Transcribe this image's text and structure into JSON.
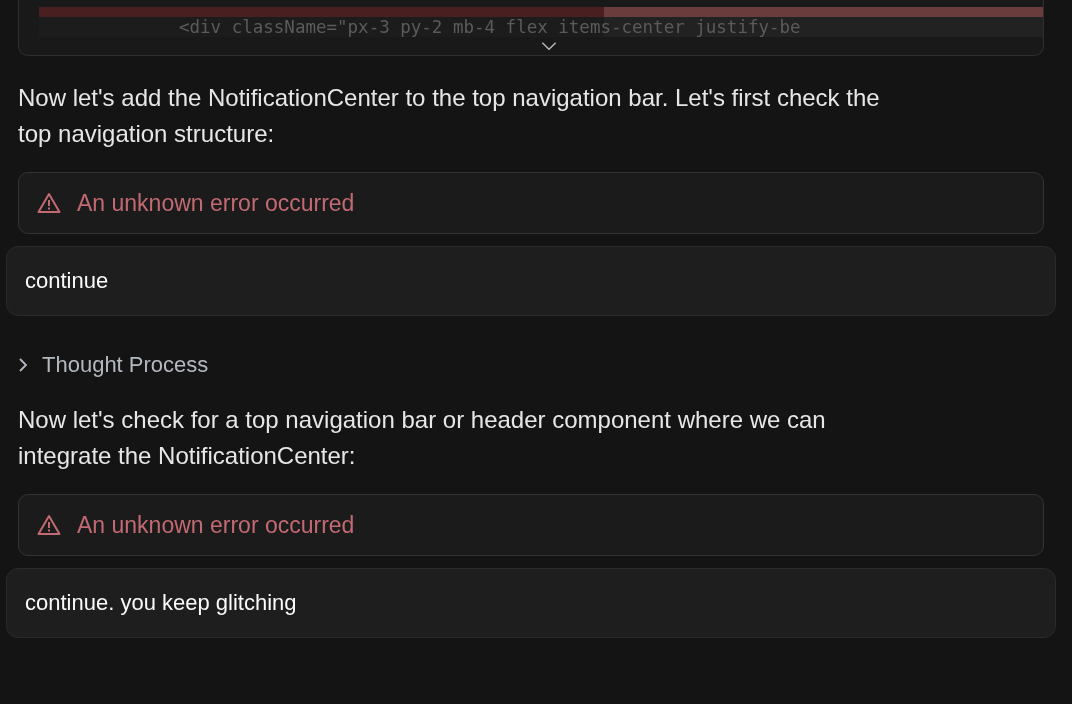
{
  "code_block": {
    "line": "<div className=\"px-3 py-2 mb-4 flex items-center justify-be"
  },
  "messages": [
    {
      "kind": "text",
      "text": "Now let's add the NotificationCenter to the top navigation bar. Let's first check the top navigation structure:"
    },
    {
      "kind": "error",
      "text": "An unknown error occurred"
    },
    {
      "kind": "user",
      "text": "continue"
    },
    {
      "kind": "thought",
      "text": "Thought Process",
      "expanded": false
    },
    {
      "kind": "text",
      "text": "Now let's check for a top navigation bar or header component where we can integrate the NotificationCenter:"
    },
    {
      "kind": "error",
      "text": "An unknown error occurred"
    },
    {
      "kind": "user",
      "text": "continue. you keep glitching"
    }
  ]
}
